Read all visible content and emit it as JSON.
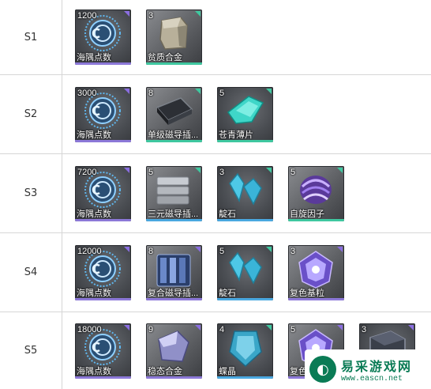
{
  "rows": [
    {
      "label": "S1",
      "items": [
        {
          "qty": "1200",
          "name": "海隅点数",
          "icon": "credit-coin-icon",
          "bar": "#8c78d8",
          "tri": "purple"
        },
        {
          "qty": "3",
          "name": "贫质合金",
          "icon": "alloy-block-icon",
          "bar": "#3fc8a0",
          "tri": "green"
        }
      ]
    },
    {
      "label": "S2",
      "items": [
        {
          "qty": "3000",
          "name": "海隅点数",
          "icon": "credit-coin-icon",
          "bar": "#8c78d8",
          "tri": "purple"
        },
        {
          "qty": "8",
          "name": "单级磁导插...",
          "icon": "magnetic-plate-icon",
          "bar": "#3fc8a0",
          "tri": "green"
        },
        {
          "qty": "5",
          "name": "苍青薄片",
          "icon": "cyan-shard-icon",
          "bar": "#3fc8a0",
          "tri": "green"
        }
      ]
    },
    {
      "label": "S3",
      "items": [
        {
          "qty": "7200",
          "name": "海隅点数",
          "icon": "credit-coin-icon",
          "bar": "#8c78d8",
          "tri": "purple"
        },
        {
          "qty": "5",
          "name": "三元磁导插...",
          "icon": "magnetic-stack-icon",
          "bar": "#4aa8e0",
          "tri": "green"
        },
        {
          "qty": "3",
          "name": "靛石",
          "icon": "indigo-crystal-icon",
          "bar": "#4aa8e0",
          "tri": "green"
        },
        {
          "qty": "5",
          "name": "自旋因子",
          "icon": "spin-factor-icon",
          "bar": "#3fc8a0",
          "tri": "green"
        }
      ]
    },
    {
      "label": "S4",
      "items": [
        {
          "qty": "12000",
          "name": "海隅点数",
          "icon": "credit-coin-icon",
          "bar": "#8c78d8",
          "tri": "purple"
        },
        {
          "qty": "8",
          "name": "复合磁导插...",
          "icon": "composite-stack-icon",
          "bar": "#8c78d8",
          "tri": "purple"
        },
        {
          "qty": "5",
          "name": "靛石",
          "icon": "indigo-crystal-icon",
          "bar": "#4aa8e0",
          "tri": "green"
        },
        {
          "qty": "3",
          "name": "复色基粒",
          "icon": "polychrome-gem-icon",
          "bar": "#8c78d8",
          "tri": "purple"
        }
      ]
    },
    {
      "label": "S5",
      "items": [
        {
          "qty": "18000",
          "name": "海隅点数",
          "icon": "credit-coin-icon",
          "bar": "#8c78d8",
          "tri": "purple"
        },
        {
          "qty": "9",
          "name": "稳态合金",
          "icon": "stable-alloy-icon",
          "bar": "#8c78d8",
          "tri": "purple"
        },
        {
          "qty": "4",
          "name": "蝶晶",
          "icon": "butterfly-crystal-icon",
          "bar": "#4aa8e0",
          "tri": "green"
        },
        {
          "qty": "5",
          "name": "复色",
          "icon": "polychrome-gem-icon",
          "bar": "#8c78d8",
          "tri": "purple"
        },
        {
          "qty": "3",
          "name": "",
          "icon": "dark-cube-icon",
          "bar": "#8c78d8",
          "tri": "purple"
        }
      ]
    }
  ],
  "watermark": {
    "title": "易采游戏网",
    "url": "www.eascn.net",
    "logo_icon": "site-logo-icon"
  }
}
